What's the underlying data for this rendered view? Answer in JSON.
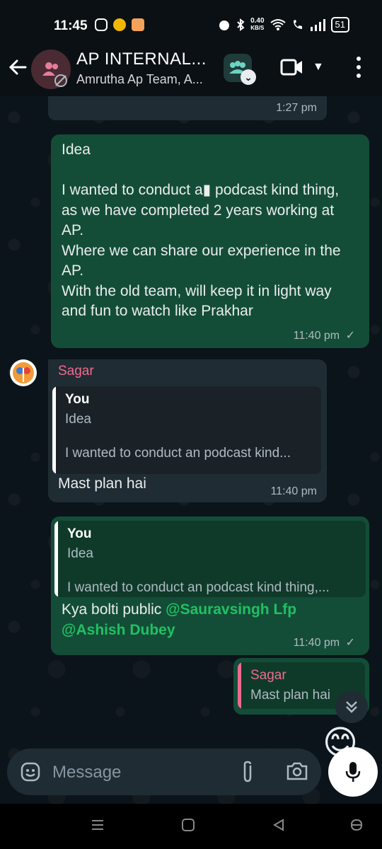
{
  "status": {
    "time": "11:45",
    "net_speed_value": "0.40",
    "net_speed_unit": "KB/S",
    "battery": "51"
  },
  "header": {
    "title": "AP INTERNAL...",
    "subtitle": "Amrutha Ap Team, A..."
  },
  "messages": {
    "prev_time": "1:27 pm",
    "m1": {
      "text": "Idea\n\nI wanted to conduct a▮ podcast kind thing, as we have completed 2 years working at AP.\nWhere we can share our experience in the AP.\nWith the old team, will keep it in light way and fun to watch like Prakhar",
      "time": "11:40 pm"
    },
    "m2": {
      "sender": "Sagar",
      "quote_author": "You",
      "quote_line1": "Idea",
      "quote_line2": "I wanted to conduct an podcast kind...",
      "text": "Mast plan hai",
      "time": "11:40 pm"
    },
    "m3": {
      "quote_author": "You",
      "quote_line1": "Idea",
      "quote_line2": "I wanted to conduct an podcast kind thing,...",
      "text_prefix": "Kya bolti public ",
      "mention1": "@Sauravsingh Lfp",
      "mention2": "@Ashish Dubey",
      "time": "11:40 pm"
    },
    "m4": {
      "quote_author": "Sagar",
      "quote_line1": "Mast plan hai"
    },
    "emoji_peek": "😊"
  },
  "composer": {
    "placeholder": "Message"
  },
  "icons": {
    "back": "arrow-left-icon",
    "video": "video-camera-icon",
    "more": "kebab-menu-icon",
    "emoji": "sticker-emoji-icon",
    "attach": "paperclip-icon",
    "camera": "camera-icon",
    "mic": "microphone-icon",
    "scroll": "double-chevron-down-icon"
  },
  "colors": {
    "outgoing_bubble": "#144d37",
    "incoming_bubble": "#202c33",
    "mention": "#21c063",
    "sender_name": "#ee6b8f"
  }
}
